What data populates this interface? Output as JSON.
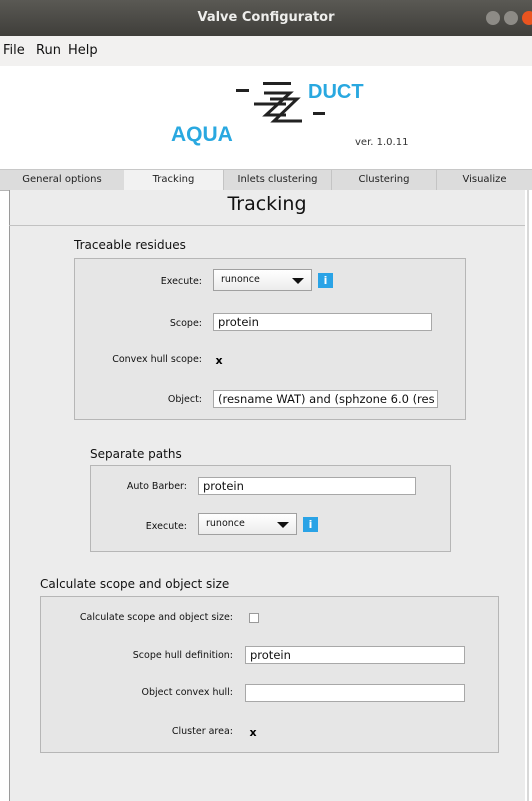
{
  "window": {
    "title": "Valve Configurator"
  },
  "menu": [
    "File",
    "Run",
    "Help"
  ],
  "logo": {
    "left": "AQUA",
    "right": "DUCT",
    "version": "ver. 1.0.11"
  },
  "tabs": [
    "General options",
    "Tracking",
    "Inlets clustering",
    "Clustering",
    "Visualize"
  ],
  "active_tab": "Tracking",
  "page_title": "Tracking",
  "traceable": {
    "title": "Traceable residues",
    "execute_label": "Execute:",
    "execute_value": "runonce",
    "scope_label": "Scope:",
    "scope_value": "protein",
    "convex_label": "Convex hull scope:",
    "convex_checked": "x",
    "object_label": "Object:",
    "object_value": "(resname WAT) and (sphzone 6.0 (res"
  },
  "separate": {
    "title": "Separate paths",
    "barber_label": "Auto Barber:",
    "barber_value": "protein",
    "execute_label": "Execute:",
    "execute_value": "runonce"
  },
  "calc": {
    "title": "Calculate scope and object size",
    "calc_label": "Calculate scope and object size:",
    "scope_hull_label": "Scope hull definition:",
    "scope_hull_value": "protein",
    "object_hull_label": "Object convex hull:",
    "object_hull_value": "",
    "cluster_label": "Cluster area:",
    "cluster_checked": "x"
  },
  "colors": {
    "accent": "#2aa3e6",
    "titlebar": "#4a4945",
    "close": "#e95420"
  }
}
